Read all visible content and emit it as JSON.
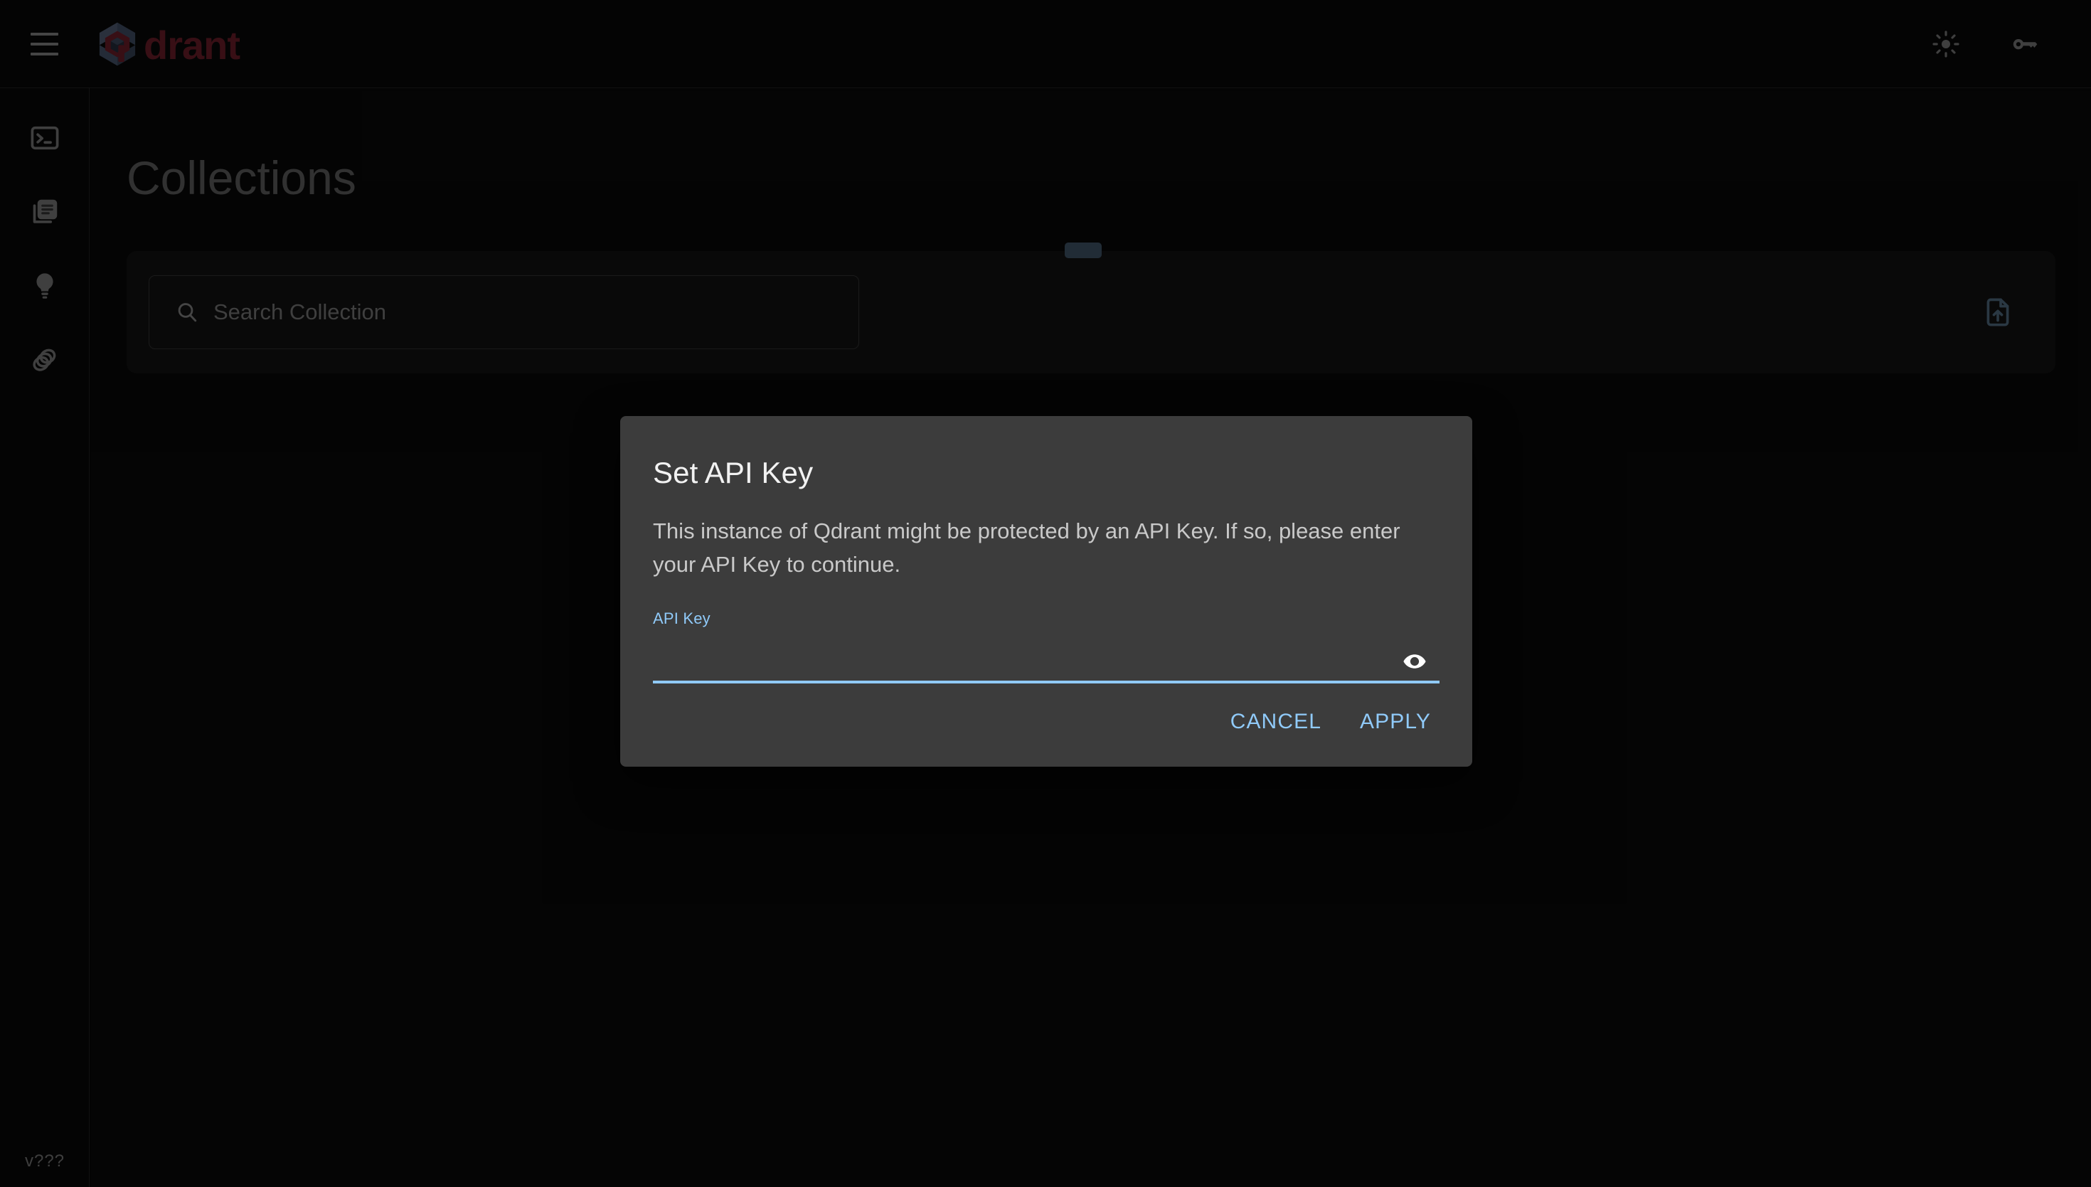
{
  "app": {
    "brand_name": "drant",
    "brand_color": "#7c2230",
    "accent_color": "#90caf9",
    "upload_icon_color": "#5d7c96",
    "version": "v???"
  },
  "header": {
    "menu_icon": "hamburger-menu-icon",
    "logo_icon": "qdrant-logo-icon",
    "theme_toggle_icon": "sun-icon",
    "api_key_icon": "key-icon"
  },
  "sidebar": {
    "items": [
      {
        "icon": "console-icon",
        "label": "Console"
      },
      {
        "icon": "collections-icon",
        "label": "Collections"
      },
      {
        "icon": "lightbulb-icon",
        "label": "Tutorial"
      },
      {
        "icon": "datasets-icon",
        "label": "Datasets"
      }
    ],
    "version": "v???"
  },
  "main": {
    "page_title": "Collections",
    "search": {
      "icon": "search-icon",
      "placeholder": "Search Collection",
      "value": ""
    },
    "upload": {
      "icon": "file-upload-icon",
      "label": "Upload snapshot"
    }
  },
  "dialog": {
    "title": "Set API Key",
    "body": "This instance of Qdrant might be protected by an API Key. If so, please enter your API Key to continue.",
    "field": {
      "label": "API Key",
      "value": "",
      "placeholder": "",
      "visibility_icon": "eye-icon"
    },
    "cancel_label": "CANCEL",
    "apply_label": "APPLY"
  }
}
